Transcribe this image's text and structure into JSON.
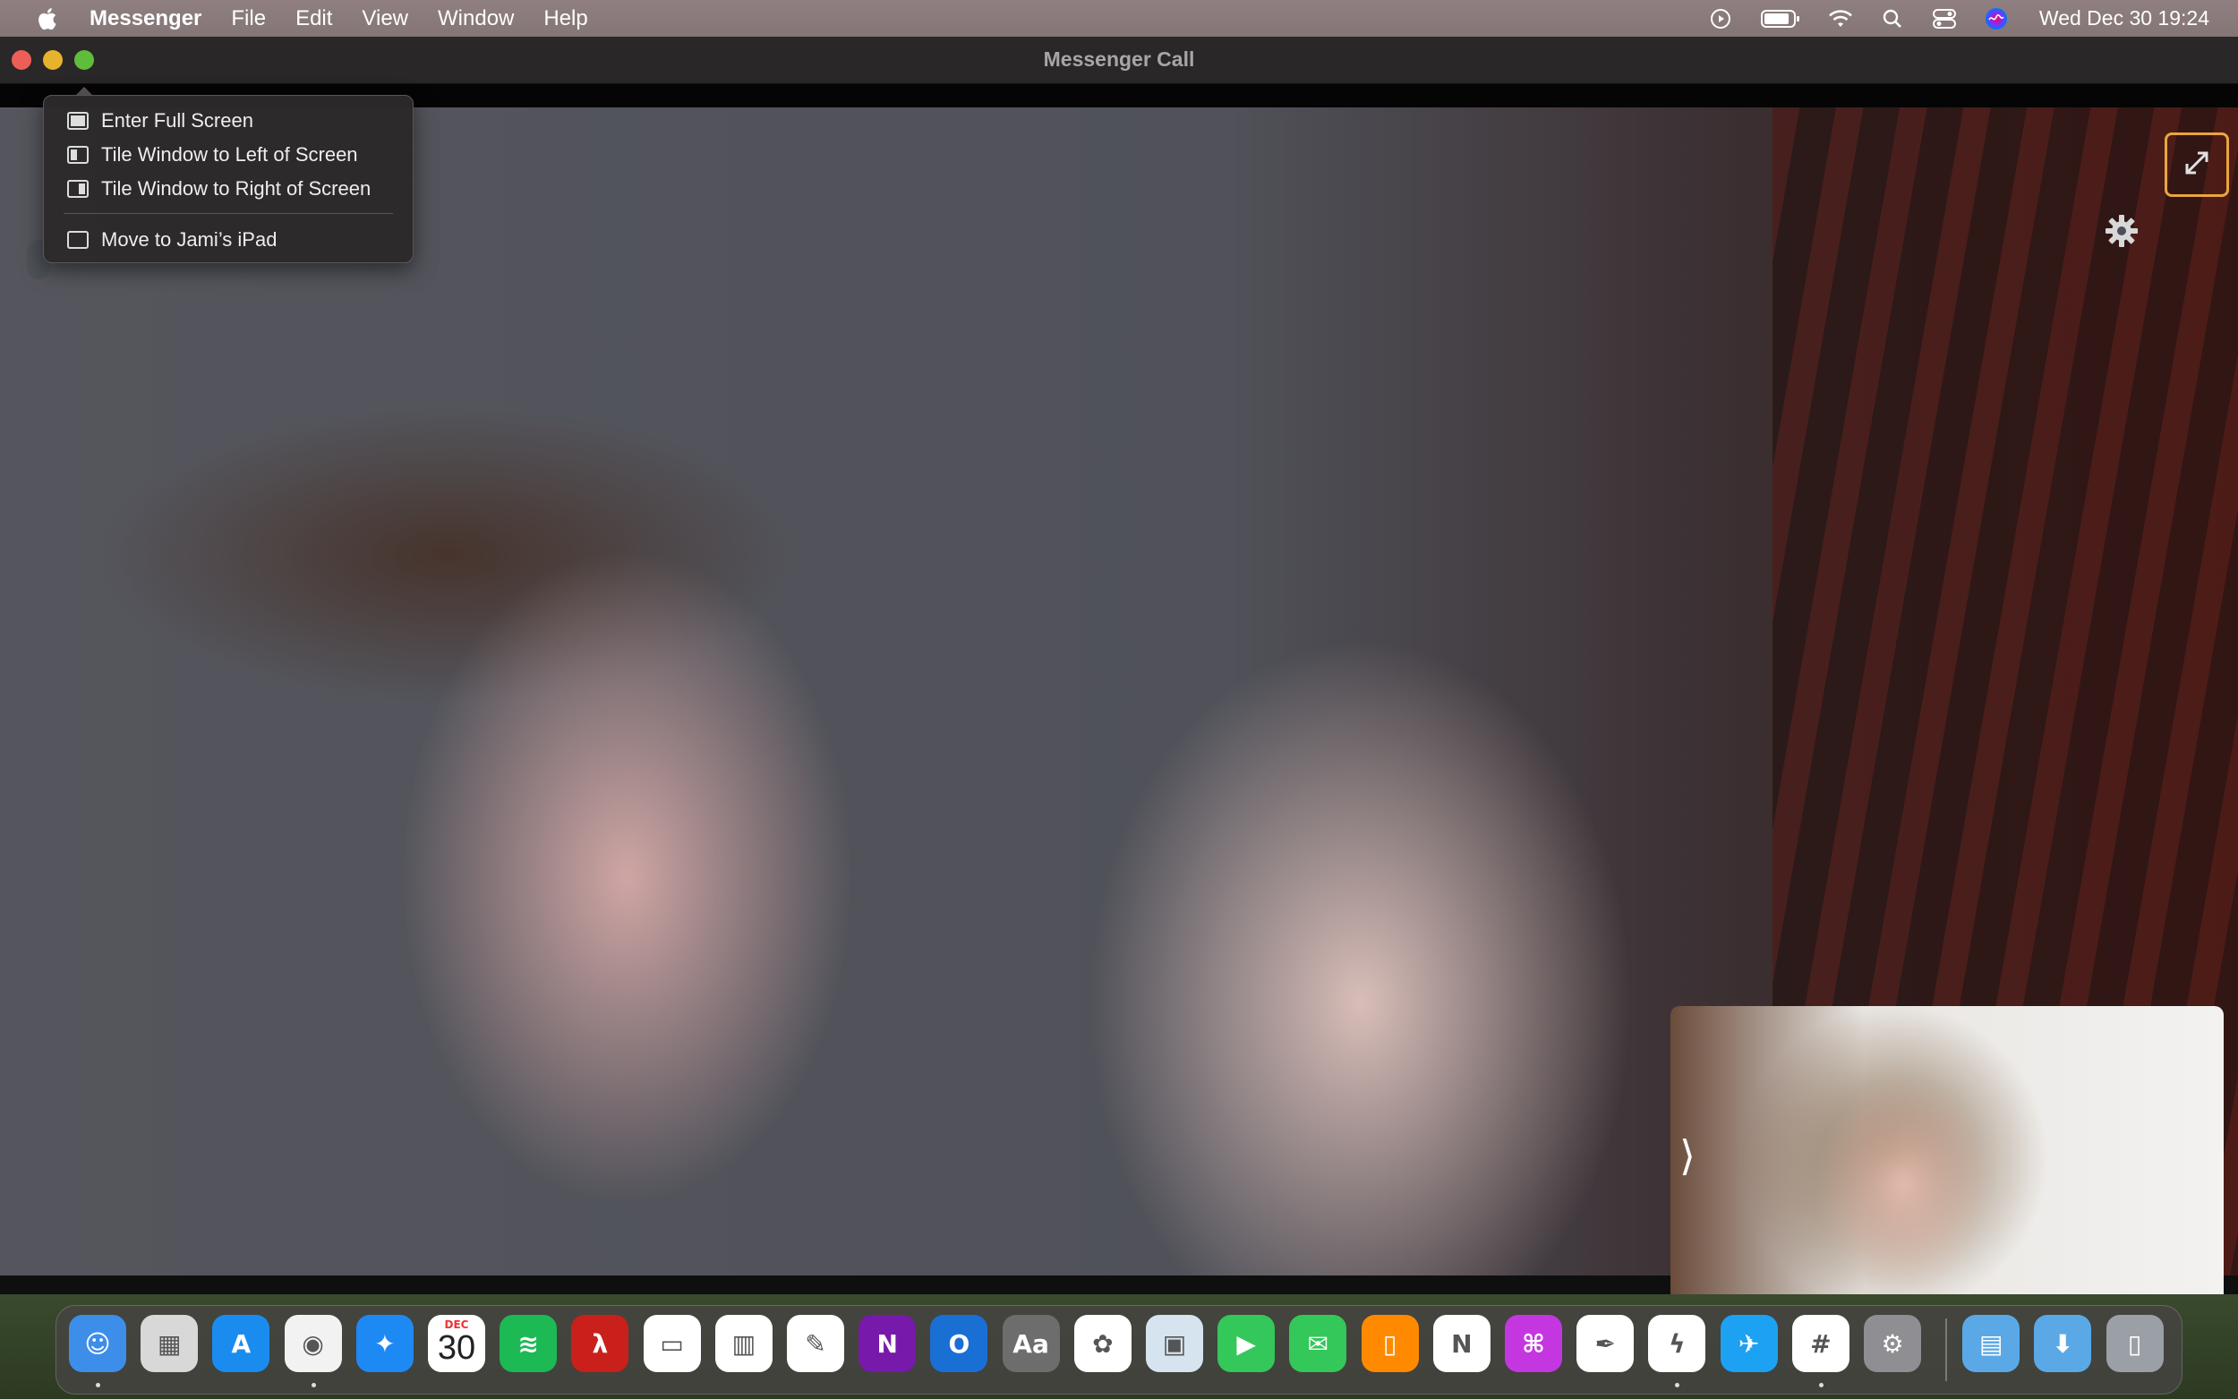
{
  "menubar": {
    "app_name": "Messenger",
    "menus": [
      "File",
      "Edit",
      "View",
      "Window",
      "Help"
    ],
    "clock": "Wed Dec 30  19:24"
  },
  "window": {
    "title": "Messenger Call"
  },
  "window_menu": {
    "items": [
      {
        "label": "Enter Full Screen",
        "icon": "fullscreen-icon"
      },
      {
        "label": "Tile Window to Left of Screen",
        "icon": "tile-left-icon"
      },
      {
        "label": "Tile Window to Right of Screen",
        "icon": "tile-right-icon"
      },
      {
        "label": "Move to Jami’s iPad",
        "icon": "ipad-icon"
      }
    ]
  },
  "self_view": {
    "chevron": "⟩"
  },
  "dock": {
    "calendar": {
      "month": "DEC",
      "day": "30"
    },
    "apps": [
      {
        "name": "finder",
        "color": "#3d8ee9"
      },
      {
        "name": "launchpad",
        "color": "#d8d8d8"
      },
      {
        "name": "app-store",
        "color": "#1a8cf0"
      },
      {
        "name": "chrome",
        "color": "#f2f2f2"
      },
      {
        "name": "safari",
        "color": "#1d89f3"
      },
      {
        "name": "calendar",
        "color": "#ffffff"
      },
      {
        "name": "spotify",
        "color": "#1db954"
      },
      {
        "name": "acrobat",
        "color": "#c9201c"
      },
      {
        "name": "keynote",
        "color": "#ffffff"
      },
      {
        "name": "numbers",
        "color": "#ffffff"
      },
      {
        "name": "pages",
        "color": "#ffffff"
      },
      {
        "name": "onenote",
        "color": "#7719aa"
      },
      {
        "name": "outlook",
        "color": "#1a6fd4"
      },
      {
        "name": "font-book",
        "color": "#6d6d6d"
      },
      {
        "name": "photos",
        "color": "#ffffff"
      },
      {
        "name": "preview",
        "color": "#d6e4ef"
      },
      {
        "name": "facetime",
        "color": "#34c759"
      },
      {
        "name": "messages",
        "color": "#34c759"
      },
      {
        "name": "books",
        "color": "#ff8a00"
      },
      {
        "name": "news",
        "color": "#ffffff"
      },
      {
        "name": "vectorize",
        "color": "#c436e0"
      },
      {
        "name": "script-editor",
        "color": "#ffffff"
      },
      {
        "name": "messenger",
        "color": "#ffffff"
      },
      {
        "name": "twitter",
        "color": "#1da1f2"
      },
      {
        "name": "slack",
        "color": "#ffffff"
      },
      {
        "name": "system-preferences",
        "color": "#8e8e93"
      },
      {
        "name": "documents-folder",
        "color": "#5aa9e6"
      },
      {
        "name": "downloads-folder",
        "color": "#5aa9e6"
      },
      {
        "name": "trash",
        "color": "#9aa0a6"
      }
    ]
  }
}
